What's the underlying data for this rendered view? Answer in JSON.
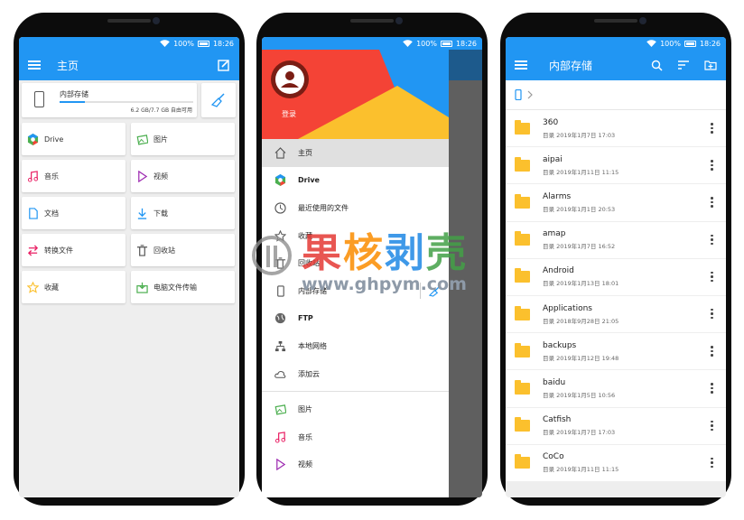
{
  "status": {
    "battery": "100%",
    "time": "18:26"
  },
  "colors": {
    "primary": "#2196f3",
    "folder": "#fbc02d",
    "red": "#f44336",
    "yellow": "#fbc02d"
  },
  "home": {
    "title": "主页",
    "storage": {
      "name": "内部存储",
      "size": "6.2 GB/7.7 GB 自由可用",
      "used_fraction": 0.19
    },
    "tiles": [
      {
        "label": "Drive",
        "icon": "drive-icon"
      },
      {
        "label": "图片",
        "icon": "image-icon"
      },
      {
        "label": "音乐",
        "icon": "music-icon"
      },
      {
        "label": "视频",
        "icon": "video-icon"
      },
      {
        "label": "文档",
        "icon": "document-icon"
      },
      {
        "label": "下载",
        "icon": "download-icon"
      },
      {
        "label": "转换文件",
        "icon": "transfer-icon"
      },
      {
        "label": "回收站",
        "icon": "trash-icon"
      },
      {
        "label": "收藏",
        "icon": "star-icon"
      },
      {
        "label": "电脑文件传输",
        "icon": "pc-transfer-icon"
      }
    ]
  },
  "drawer": {
    "login": "登录",
    "items": [
      {
        "label": "主页",
        "icon": "home-icon"
      },
      {
        "label": "Drive",
        "icon": "drive-icon"
      },
      {
        "label": "最近使用的文件",
        "icon": "clock-icon"
      },
      {
        "label": "收藏",
        "icon": "star-icon"
      },
      {
        "label": "回收站",
        "icon": "trash-icon"
      },
      {
        "label": "内部存储",
        "icon": "phone-icon"
      },
      {
        "label": "FTP",
        "icon": "globe-icon"
      },
      {
        "label": "本地网络",
        "icon": "network-icon"
      },
      {
        "label": "添加云",
        "icon": "cloud-icon"
      },
      {
        "label": "图片",
        "icon": "image-icon"
      },
      {
        "label": "音乐",
        "icon": "music-icon"
      },
      {
        "label": "视频",
        "icon": "video-icon"
      }
    ]
  },
  "browser": {
    "title": "内部存储",
    "folders": [
      {
        "name": "360",
        "meta": "目录 2019年1月7日 17:03"
      },
      {
        "name": "aipai",
        "meta": "目录 2019年1月11日 11:15"
      },
      {
        "name": "Alarms",
        "meta": "目录 2019年1月1日 20:53"
      },
      {
        "name": "amap",
        "meta": "目录 2019年1月7日 16:52"
      },
      {
        "name": "Android",
        "meta": "目录 2019年1月13日 18:01"
      },
      {
        "name": "Applications",
        "meta": "目录 2018年9月28日 21:05"
      },
      {
        "name": "backups",
        "meta": "目录 2019年1月12日 19:48"
      },
      {
        "name": "baidu",
        "meta": "目录 2019年1月5日 10:56"
      },
      {
        "name": "Catfish",
        "meta": "目录 2019年1月7日 17:03"
      },
      {
        "name": "CoCo",
        "meta": "目录 2019年1月11日 11:15"
      }
    ]
  },
  "watermark": {
    "title": "果核剥壳",
    "url": "www.ghpym.com"
  }
}
